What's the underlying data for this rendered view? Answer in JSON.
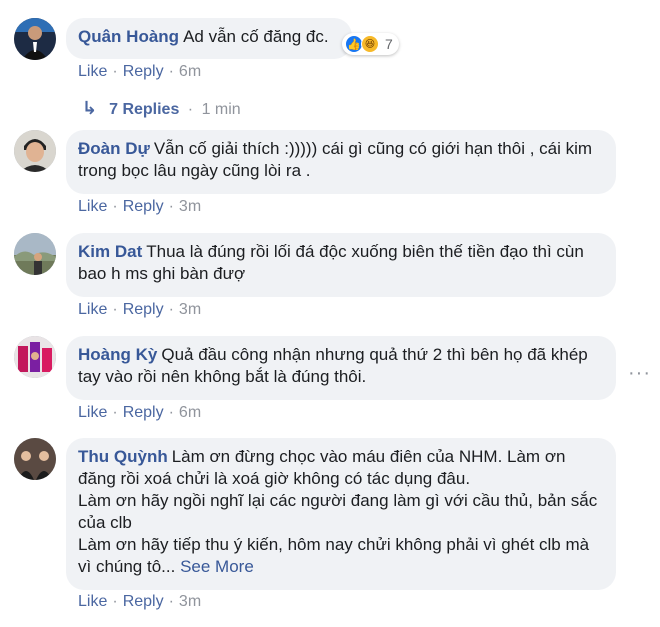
{
  "comments": [
    {
      "name": "Quân Hoàng",
      "text": "Ad vẫn cố đăng đc.",
      "reactions": {
        "icons": [
          "like-icon",
          "haha-icon"
        ],
        "count": "7"
      },
      "like": "Like",
      "reply": "Reply",
      "time": "6m"
    },
    {
      "name": "Đoàn Dự",
      "text": "Vẫn cố giải thích :))))) cái gì cũng có giới hạn thôi , cái kim trong bọc lâu ngày cũng lòi ra .",
      "like": "Like",
      "reply": "Reply",
      "time": "3m"
    },
    {
      "name": "Kim Dat",
      "text": "Thua là đúng rồi lối đá độc xuống biên thế tiền đạo thì cùn bao h ms ghi bàn đượ",
      "like": "Like",
      "reply": "Reply",
      "time": "3m"
    },
    {
      "name": "Hoàng Kỳ",
      "text": "Quả đầu công nhận nhưng quả thứ 2 thì bên họ đã khép tay vào rồi nên không bắt là đúng thôi.",
      "like": "Like",
      "reply": "Reply",
      "time": "6m"
    },
    {
      "name": "Thu Quỳnh",
      "text_lines": [
        "Làm ơn đừng chọc vào máu điên của NHM. Làm ơn đăng rồi xoá chửi là xoá giờ không có tác dụng đâu.",
        "Làm ơn hãy ngồi nghĩ lại các người đang làm gì với cầu thủ, bản sắc của clb",
        "Làm ơn hãy tiếp thu ý kiến, hôm nay chửi không phải vì ghét clb mà vì chúng tô..."
      ],
      "see_more": "See More",
      "like": "Like",
      "reply": "Reply",
      "time": "3m"
    }
  ],
  "replies_link": {
    "label": "7 Replies",
    "time": "1 min"
  },
  "more_options": "···",
  "colors": {
    "name": "#385898",
    "bubble": "#f0f2f5",
    "meta": "#90949c"
  }
}
